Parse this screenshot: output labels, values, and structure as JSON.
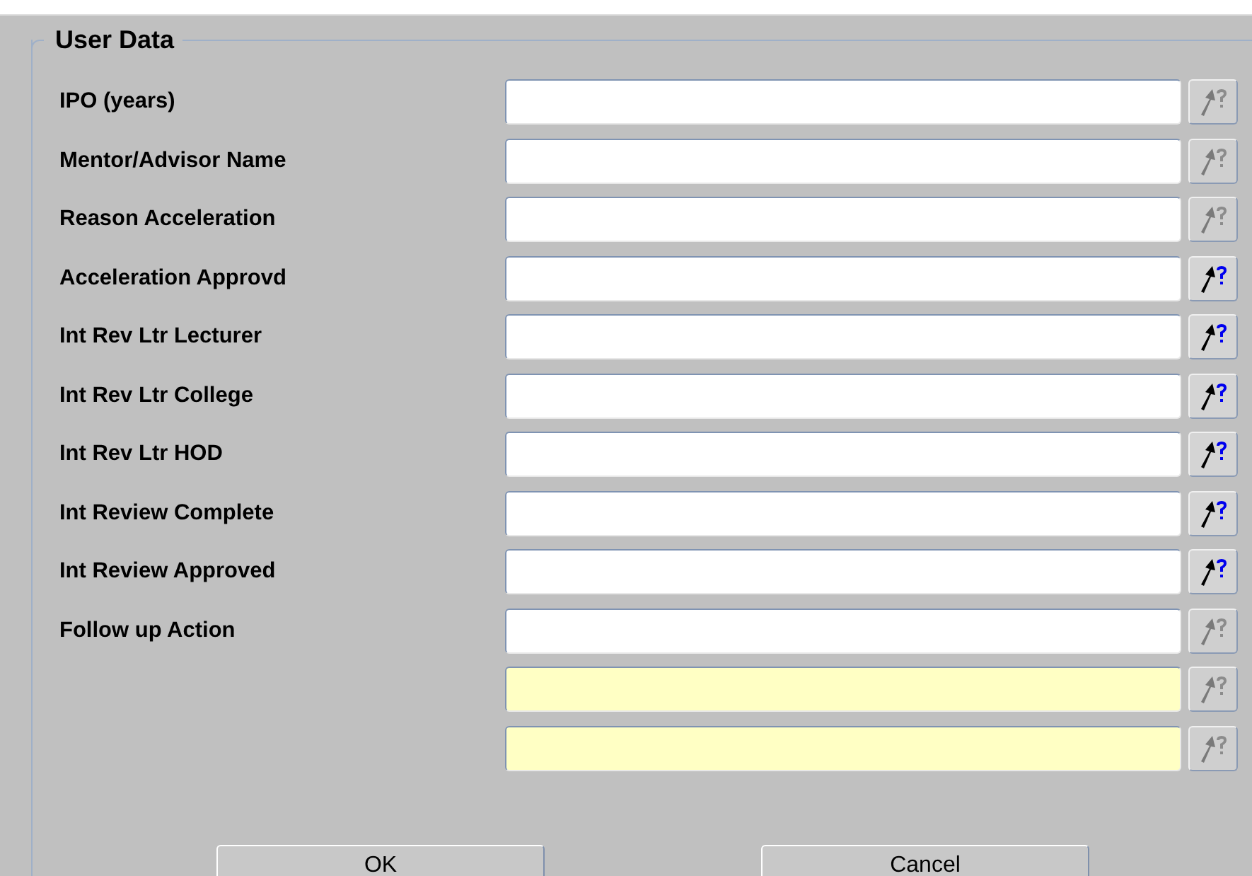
{
  "group": {
    "title": "User Data"
  },
  "fields": [
    {
      "label": "IPO (years)",
      "highlighted": false,
      "lov_disabled": true
    },
    {
      "label": "Mentor/Advisor Name",
      "highlighted": false,
      "lov_disabled": true
    },
    {
      "label": "Reason Acceleration",
      "highlighted": false,
      "lov_disabled": true
    },
    {
      "label": "Acceleration Approvd",
      "highlighted": false,
      "lov_disabled": false
    },
    {
      "label": "Int Rev Ltr Lecturer",
      "highlighted": false,
      "lov_disabled": false
    },
    {
      "label": "Int Rev Ltr College",
      "highlighted": false,
      "lov_disabled": false
    },
    {
      "label": "Int Rev Ltr HOD",
      "highlighted": false,
      "lov_disabled": false
    },
    {
      "label": "Int Review Complete",
      "highlighted": false,
      "lov_disabled": false
    },
    {
      "label": "Int Review Approved",
      "highlighted": false,
      "lov_disabled": false
    },
    {
      "label": "Follow up Action",
      "highlighted": false,
      "lov_disabled": true
    },
    {
      "highlighted": true,
      "lov_disabled": true
    },
    {
      "highlighted": true,
      "lov_disabled": true
    }
  ],
  "buttons": [
    "OK",
    "Cancel"
  ]
}
